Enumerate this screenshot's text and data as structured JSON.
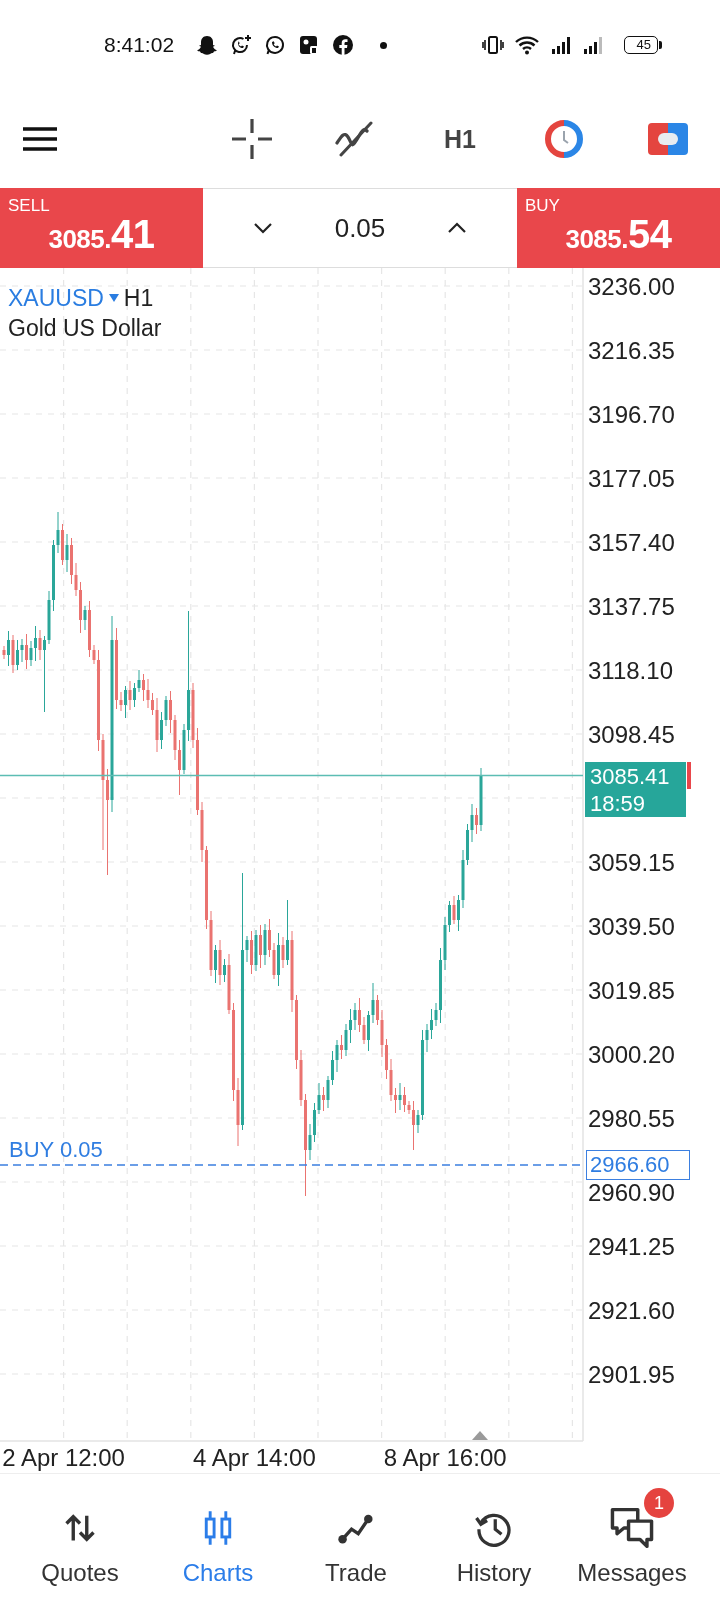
{
  "status_bar": {
    "time": "8:41:02",
    "battery": "45"
  },
  "toolbar": {
    "timeframe": "H1"
  },
  "trade_bar": {
    "sell": {
      "label": "SELL",
      "price": "3085.**41**"
    },
    "volume": "0.05",
    "buy": {
      "label": "BUY",
      "price": "3085.**54**"
    }
  },
  "chart": {
    "symbol": "XAUUSD",
    "timeframe": "H1",
    "description": "Gold US Dollar",
    "price_scale": [
      "3236.00",
      "3216.35",
      "3196.70",
      "3177.05",
      "3157.40",
      "3137.75",
      "3118.10",
      "3098.45",
      "3059.15",
      "3039.50",
      "3019.85",
      "3000.20",
      "2980.55",
      "2960.90",
      "2941.25",
      "2921.60",
      "2901.95"
    ],
    "time_scale": [
      "2 Apr 12:00",
      "4 Apr 14:00",
      "8 Apr 16:00"
    ],
    "current_price": {
      "price": "3085.41",
      "countdown": "18:59"
    },
    "position": {
      "label": "BUY 0.05",
      "price": "2966.60"
    }
  },
  "bottom_nav": [
    {
      "label": "Quotes",
      "selected": false
    },
    {
      "label": "Charts",
      "selected": true
    },
    {
      "label": "Trade",
      "selected": false
    },
    {
      "label": "History",
      "selected": false
    },
    {
      "label": "Messages",
      "selected": false,
      "badge": "1"
    }
  ]
}
